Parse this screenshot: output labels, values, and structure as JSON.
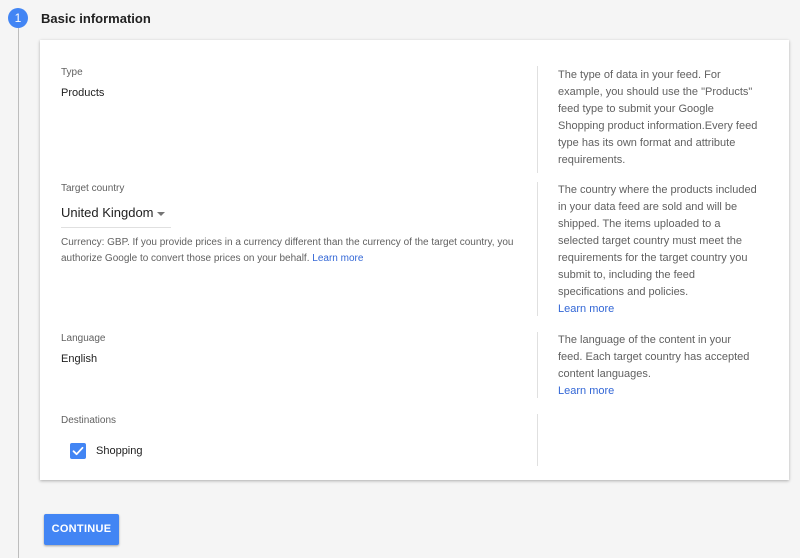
{
  "step": {
    "number": "1",
    "title": "Basic information"
  },
  "type_field": {
    "label": "Type",
    "value": "Products",
    "help": "The type of data in your feed. For example, you should use the \"Products\" feed type to submit your Google Shopping product information.Every feed type has its own format and attribute requirements."
  },
  "country_field": {
    "label": "Target country",
    "value": "United Kingdom",
    "hint": "Currency: GBP. If you provide prices in a currency different than the currency of the target country, you authorize Google to convert those prices on your behalf.",
    "hint_link": "Learn more",
    "help": "The country where the products included in your data feed are sold and will be shipped. The items uploaded to a selected target country must meet the requirements for the target country you submit to, including the feed specifications and policies.",
    "help_link": "Learn more"
  },
  "language_field": {
    "label": "Language",
    "value": "English",
    "help": "The language of the content in your feed. Each target country has accepted content languages.",
    "help_link": "Learn more"
  },
  "destinations_field": {
    "label": "Destinations",
    "options": [
      {
        "label": "Shopping",
        "checked": true
      }
    ]
  },
  "actions": {
    "continue_label": "CONTINUE"
  },
  "colors": {
    "accent": "#4285f4",
    "link": "#3367d6"
  }
}
